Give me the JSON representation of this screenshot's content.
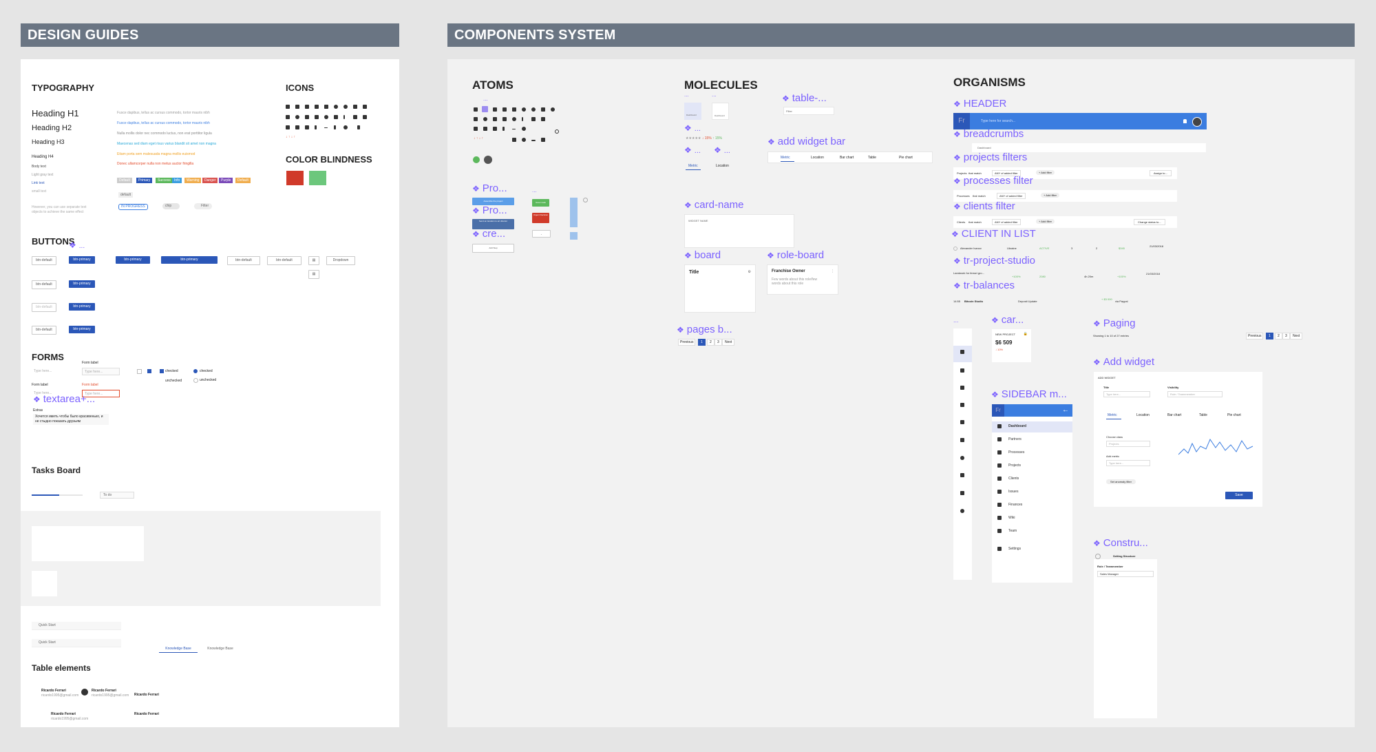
{
  "sections": {
    "design_guides": "DESIGN GUIDES",
    "components_system": "COMPONENTS SYSTEM"
  },
  "design": {
    "typography": "TYPOGRAPHY",
    "h1": "Heading H1",
    "h2": "Heading H2",
    "h3": "Heading H3",
    "h4": "Heading H4",
    "body": "Body text",
    "light": "Light gray text",
    "link": "Link text",
    "small": "small text",
    "sample_text": "Fusce dapibus, tellus ac cursus commodo, tortor mauris nibh",
    "sample_text2": "Nulla mollis dolor nec commodo luctus, non erat porttitor ligula",
    "sample_text3": "Maecenas sed diam eget risus varius blandit sit amet non magna",
    "sample_text4": "Etiam porta sem malesuada magna mollis euismod",
    "sample_text5": "Donec ullamcorper nulla non metus auctor fringilla",
    "note": "However, you can use separate text objects to achieve the same effect",
    "default_tag": "default",
    "tags": [
      "Default",
      "Primary",
      "Success",
      "Info",
      "Warning",
      "Danger",
      "Purple",
      "Default"
    ],
    "in_progress": "IN PROGRESS",
    "chip": "chip",
    "filter_chip": "Filter",
    "icons": "ICONS",
    "color_blindness": "COLOR BLINDNESS",
    "buttons": "BUTTONS",
    "btn_default": "btn-default",
    "btn_primary": "btn-primary",
    "dropdown": "Dropdown",
    "forms": "FORMS",
    "form_label": "Form label",
    "type_here": "Type here...",
    "checked": "checked",
    "unchecked": "unchecked",
    "textarea": "textarea+...",
    "extras": "Extras",
    "extras_text": "Хочется иметь чтобы было красивенько, и не стыдно показать друзьям",
    "tasks_board": "Tasks Board",
    "to_do": "To do",
    "quick_start": "Quick Start",
    "knowledge_base": "Knowledge Base",
    "table_elements": "Table elements",
    "person_name": "Ricardo Ferrari",
    "person_email": "ricardo1995@gmail.com"
  },
  "components": {
    "atoms": "ATOMS",
    "molecules": "MOLECULES",
    "organisms": "ORGANISMS",
    "pro1": "Pro...",
    "pro2": "Pro...",
    "cre": "cre...",
    "assemble_project": "Assemble the project",
    "send_to_director": "Send an iteration to art director",
    "add_step": "Add Step",
    "green_task": "Green task",
    "urgent": "Urgent Decision",
    "dots": "...",
    "dashboard": "Dashboard",
    "table_comp": "table-...",
    "add_widget_bar": "add widget bar",
    "metric": "Metric",
    "location": "Location",
    "bar_chart": "Bar chart",
    "table": "Table",
    "pie_chart": "Pie chart",
    "card_name": "card-name",
    "widget_name": "WIDGET NAME",
    "board": "board",
    "role_board": "role-board",
    "title": "Title",
    "franchise_owner": "Franchise Owner",
    "franchise_desc": "Few words about this role/few words about this role",
    "pages_b": "pages b...",
    "previous": "Previous",
    "next": "Next",
    "header": "HEADER",
    "breadcrumbs": "breadcrumbs",
    "search_placeholder": "Type here for search...",
    "projects_filters": "projects filters",
    "processes_filter": "processes filter",
    "clients_filter": "clients filter",
    "client_in_list": "CLIENT IN LIST",
    "tr_project_studio": "tr-project-studio",
    "tr_balances": "tr-balances",
    "projects_label": "Projects",
    "processes_label": "Processes",
    "clients_label": "Clients",
    "that_match": "that match",
    "any_filter": "ANY of added filter",
    "add_filter": "+ Add filter",
    "assign_to": "Assign to...",
    "change_status": "Change status to...",
    "client_name": "Alexander Ivanov",
    "country": "Ukraine",
    "active": "ACTIVE",
    "date1": "21/03/2018",
    "landing": "Landwork for ferrari gro...",
    "balance_name": "Bitcoin Studio",
    "deposit": "Deposit Update",
    "via_paypal": "via Paypal",
    "car": "car...",
    "new_project": "NEW PROJECT",
    "amount": "$6 509",
    "paging": "Paging",
    "showing": "Showing 1 to 10 of 27 entries",
    "add_widget": "Add widget",
    "add_widget_caps": "ADD WIDGET",
    "visibility": "Visibility",
    "role_team": "Role / Teammember",
    "choose_class": "Choose class",
    "projects_opt": "Projects",
    "add_metric": "Add metric",
    "set_anomaly": "Set anomaly filter",
    "save": "Save",
    "sidebar_m": "SIDEBAR m...",
    "sidebar_items": [
      "Dashboard",
      "Partners",
      "Processes",
      "Projects",
      "Clients",
      "Issues",
      "Finances",
      "Wiki",
      "Team",
      "Settings"
    ],
    "constru": "Constru...",
    "setting_structure": "Setting Structure",
    "sales_manager": "Sales Manager",
    "logo": "Fr"
  },
  "colors": {
    "accent": "#2b57b8",
    "purple_label": "#7b61ff",
    "header_blue": "#3b7de0",
    "red_swatch": "#d03a2a",
    "green_swatch": "#6cc77c",
    "section_header": "#6a7583"
  }
}
